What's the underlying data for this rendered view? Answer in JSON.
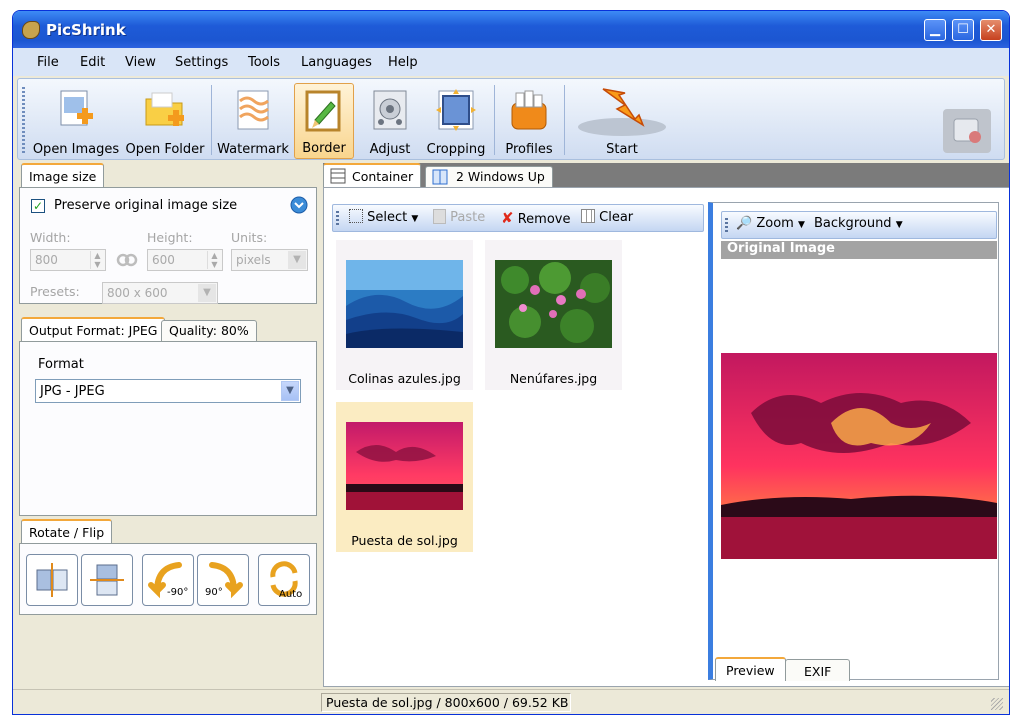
{
  "window": {
    "title": "PicShrink"
  },
  "menu": [
    "File",
    "Edit",
    "View",
    "Settings",
    "Tools",
    "Languages",
    "Help"
  ],
  "toolbar": {
    "open_images": "Open Images",
    "open_folder": "Open Folder",
    "watermark": "Watermark",
    "border": "Border",
    "adjust": "Adjust",
    "cropping": "Cropping",
    "profiles": "Profiles",
    "start": "Start"
  },
  "image_size": {
    "tab_label": "Image size",
    "preserve_label": "Preserve original image size",
    "preserve_checked": true,
    "width_label": "Width:",
    "width_value": "800",
    "height_label": "Height:",
    "height_value": "600",
    "units_label": "Units:",
    "units_value": "pixels",
    "presets_label": "Presets:",
    "presets_value": "800 x 600"
  },
  "output": {
    "tab_format": "Output Format: JPEG",
    "tab_quality": "Quality: 80%",
    "format_label": "Format",
    "format_value": "JPG - JPEG"
  },
  "rotate": {
    "tab_label": "Rotate / Flip",
    "ccw_label": "-90°",
    "cw_label": "90°",
    "auto_label": "Auto"
  },
  "view_tabs": {
    "container": "Container",
    "windows_up": "2 Windows Up"
  },
  "container_toolbar": {
    "select": "Select",
    "paste": "Paste",
    "remove": "Remove",
    "clear": "Clear"
  },
  "thumbnails": [
    {
      "name": "Colinas azules.jpg",
      "selected": false
    },
    {
      "name": "Nenúfares.jpg",
      "selected": false
    },
    {
      "name": "Puesta de sol.jpg",
      "selected": true
    }
  ],
  "preview": {
    "zoom": "Zoom",
    "background": "Background",
    "header": "Original Image",
    "tab_preview": "Preview",
    "tab_exif": "EXIF"
  },
  "status": {
    "text": "Puesta de sol.jpg / 800x600 / 69.52 KB"
  },
  "colors": {
    "titlebar": "#1e5bd8",
    "selection": "#fbecc2",
    "tab_highlight": "#f3a83b"
  }
}
